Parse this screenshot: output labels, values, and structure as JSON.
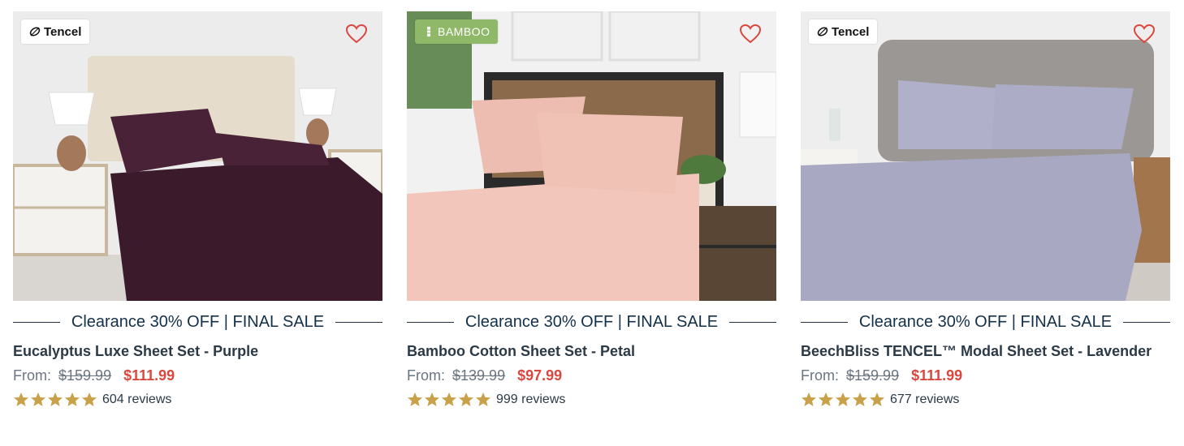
{
  "products": [
    {
      "brand_badge": "Tencel",
      "badge_icon": "leaf-icon",
      "promo": "Clearance 30% OFF | FINAL SALE",
      "name": "Eucalyptus Luxe Sheet Set - Purple",
      "from_label": "From:",
      "original_price": "$159.99",
      "sale_price": "$111.99",
      "rating": 5,
      "reviews": "604 reviews",
      "sheet_color": "#3b1a2c"
    },
    {
      "brand_badge": "BAMBOO",
      "badge_icon": "bamboo-icon",
      "promo": "Clearance 30% OFF | FINAL SALE",
      "name": "Bamboo Cotton Sheet Set - Petal",
      "from_label": "From:",
      "original_price": "$139.99",
      "sale_price": "$97.99",
      "rating": 5,
      "reviews": "999 reviews",
      "sheet_color": "#f2c6bb"
    },
    {
      "brand_badge": "Tencel",
      "badge_icon": "leaf-icon",
      "promo": "Clearance 30% OFF | FINAL SALE",
      "name": "BeechBliss TENCEL™ Modal Sheet Set - Lavender",
      "from_label": "From:",
      "original_price": "$159.99",
      "sale_price": "$111.99",
      "rating": 5,
      "reviews": "677 reviews",
      "sheet_color": "#a9a8c2"
    }
  ],
  "colors": {
    "sale": "#d9473f",
    "heading": "#13314a",
    "star": "#c9a14a"
  }
}
